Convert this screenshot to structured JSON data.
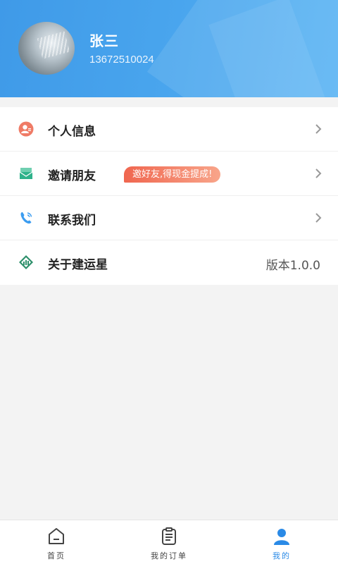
{
  "profile": {
    "name": "张三",
    "phone": "13672510024"
  },
  "menu": [
    {
      "label": "个人信息",
      "icon": "user-info-icon"
    },
    {
      "label": "邀请朋友",
      "icon": "invite-icon",
      "badge": "邀好友,得现金提成!"
    },
    {
      "label": "联系我们",
      "icon": "phone-icon"
    },
    {
      "label": "关于建运星",
      "icon": "app-logo-icon",
      "version": "版本1.0.0"
    }
  ],
  "tabs": [
    {
      "label": "首页",
      "icon": "home-icon"
    },
    {
      "label": "我的订单",
      "icon": "orders-icon"
    },
    {
      "label": "我的",
      "icon": "profile-icon",
      "active": true
    }
  ],
  "colors": {
    "header": "#4aa6ee",
    "accent": "#2a8ae6",
    "badge_start": "#f0664f",
    "badge_end": "#f8a58a"
  }
}
